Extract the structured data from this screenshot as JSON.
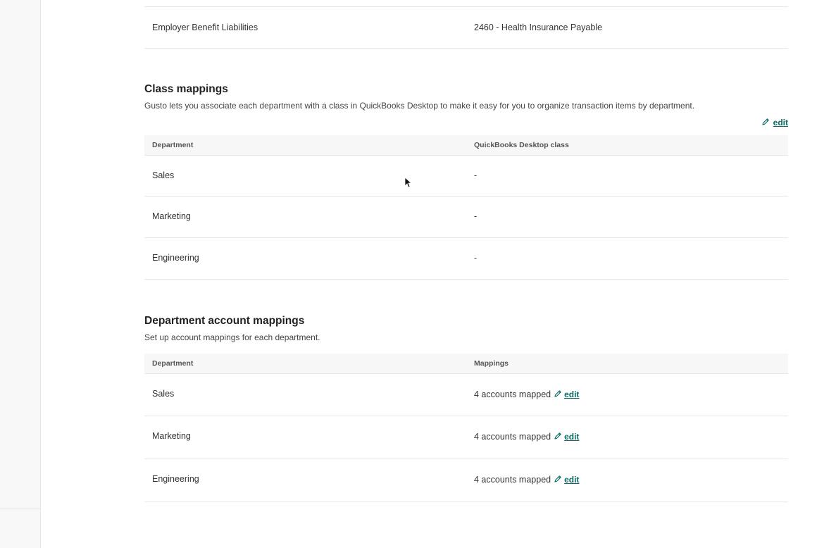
{
  "benefit_row": {
    "label": "Employer Benefit Liabilities",
    "value": "2460 - Health Insurance Payable"
  },
  "class_mappings": {
    "title": "Class mappings",
    "description": "Gusto lets you associate each department with a class in QuickBooks Desktop to make it easy for you to organize transaction items by department.",
    "edit_label": "edit",
    "columns": [
      "Department",
      "QuickBooks Desktop class"
    ],
    "rows": [
      {
        "department": "Sales",
        "class": "-"
      },
      {
        "department": "Marketing",
        "class": "-"
      },
      {
        "department": "Engineering",
        "class": "-"
      }
    ]
  },
  "department_mappings": {
    "title": "Department account mappings",
    "description": "Set up account mappings for each department.",
    "columns": [
      "Department",
      "Mappings"
    ],
    "rows": [
      {
        "department": "Sales",
        "mappings": "4 accounts mapped",
        "edit_label": "edit"
      },
      {
        "department": "Marketing",
        "mappings": "4 accounts mapped",
        "edit_label": "edit"
      },
      {
        "department": "Engineering",
        "mappings": "4 accounts mapped",
        "edit_label": "edit"
      }
    ]
  },
  "colors": {
    "link": "#0a6b63",
    "header_bg": "#f7f7f7",
    "border": "#e8e8e8"
  },
  "icons": [
    "pencil-icon",
    "cursor-arrow-icon"
  ]
}
